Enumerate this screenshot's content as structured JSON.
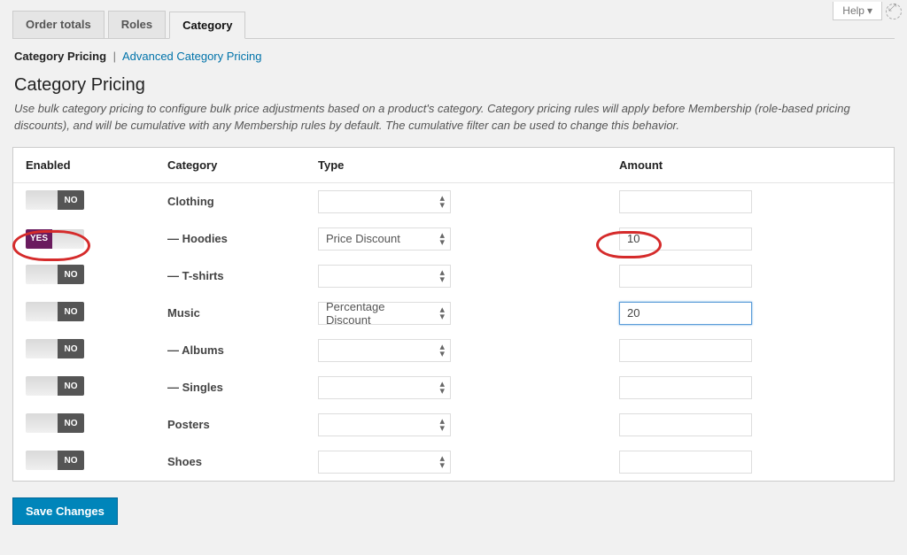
{
  "help_label": "Help",
  "tabs": [
    "Order totals",
    "Roles",
    "Category"
  ],
  "active_tab_index": 2,
  "subnav": {
    "current": "Category Pricing",
    "link": "Advanced Category Pricing"
  },
  "section_title": "Category Pricing",
  "description": "Use bulk category pricing to configure bulk price adjustments based on a product's category. Category pricing rules will apply before Membership (role-based pricing discounts), and will be cumulative with any Membership rules by default. The cumulative filter can be used to change this behavior.",
  "columns": {
    "enabled": "Enabled",
    "category": "Category",
    "type": "Type",
    "amount": "Amount"
  },
  "toggle_labels": {
    "on": "YES",
    "off": "NO"
  },
  "rows": [
    {
      "enabled": false,
      "name": "Clothing",
      "indent": 0,
      "type": "",
      "amount": ""
    },
    {
      "enabled": true,
      "name": "Hoodies",
      "indent": 1,
      "type": "Price Discount",
      "amount": "10"
    },
    {
      "enabled": false,
      "name": "T-shirts",
      "indent": 1,
      "type": "",
      "amount": ""
    },
    {
      "enabled": false,
      "name": "Music",
      "indent": 0,
      "type": "Percentage Discount",
      "amount": "20",
      "amount_focused": true
    },
    {
      "enabled": false,
      "name": "Albums",
      "indent": 1,
      "type": "",
      "amount": ""
    },
    {
      "enabled": false,
      "name": "Singles",
      "indent": 1,
      "type": "",
      "amount": ""
    },
    {
      "enabled": false,
      "name": "Posters",
      "indent": 0,
      "type": "",
      "amount": ""
    },
    {
      "enabled": false,
      "name": "Shoes",
      "indent": 0,
      "type": "",
      "amount": ""
    }
  ],
  "save_label": "Save Changes"
}
